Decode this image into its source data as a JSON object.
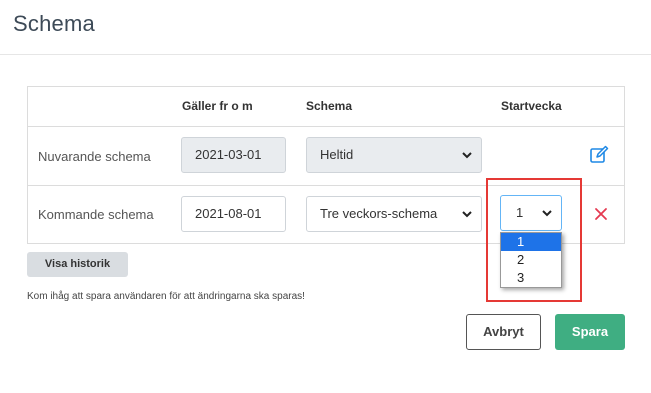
{
  "page": {
    "title": "Schema"
  },
  "table": {
    "headers": {
      "valid_from": "Gäller fr o m",
      "schedule": "Schema",
      "start_week": "Startvecka"
    },
    "rows": [
      {
        "label": "Nuvarande schema",
        "valid_from": "2021-03-01",
        "schedule": "Heltid",
        "action_icon": "edit-icon"
      },
      {
        "label": "Kommande schema",
        "valid_from": "2021-08-01",
        "schedule": "Tre veckors-schema",
        "start_week": "1",
        "start_week_options": [
          "1",
          "2",
          "3"
        ],
        "action_icon": "delete-icon"
      }
    ]
  },
  "buttons": {
    "history": "Visa historik",
    "cancel": "Avbryt",
    "save": "Spara"
  },
  "note": "Kom ihåg att spara användaren för att ändringarna ska sparas!",
  "colors": {
    "save_button": "#3fae82",
    "edit_icon": "#1e88e5",
    "delete_icon": "#e53950",
    "highlight_box": "#e53935",
    "selected_option": "#1e73e8"
  }
}
